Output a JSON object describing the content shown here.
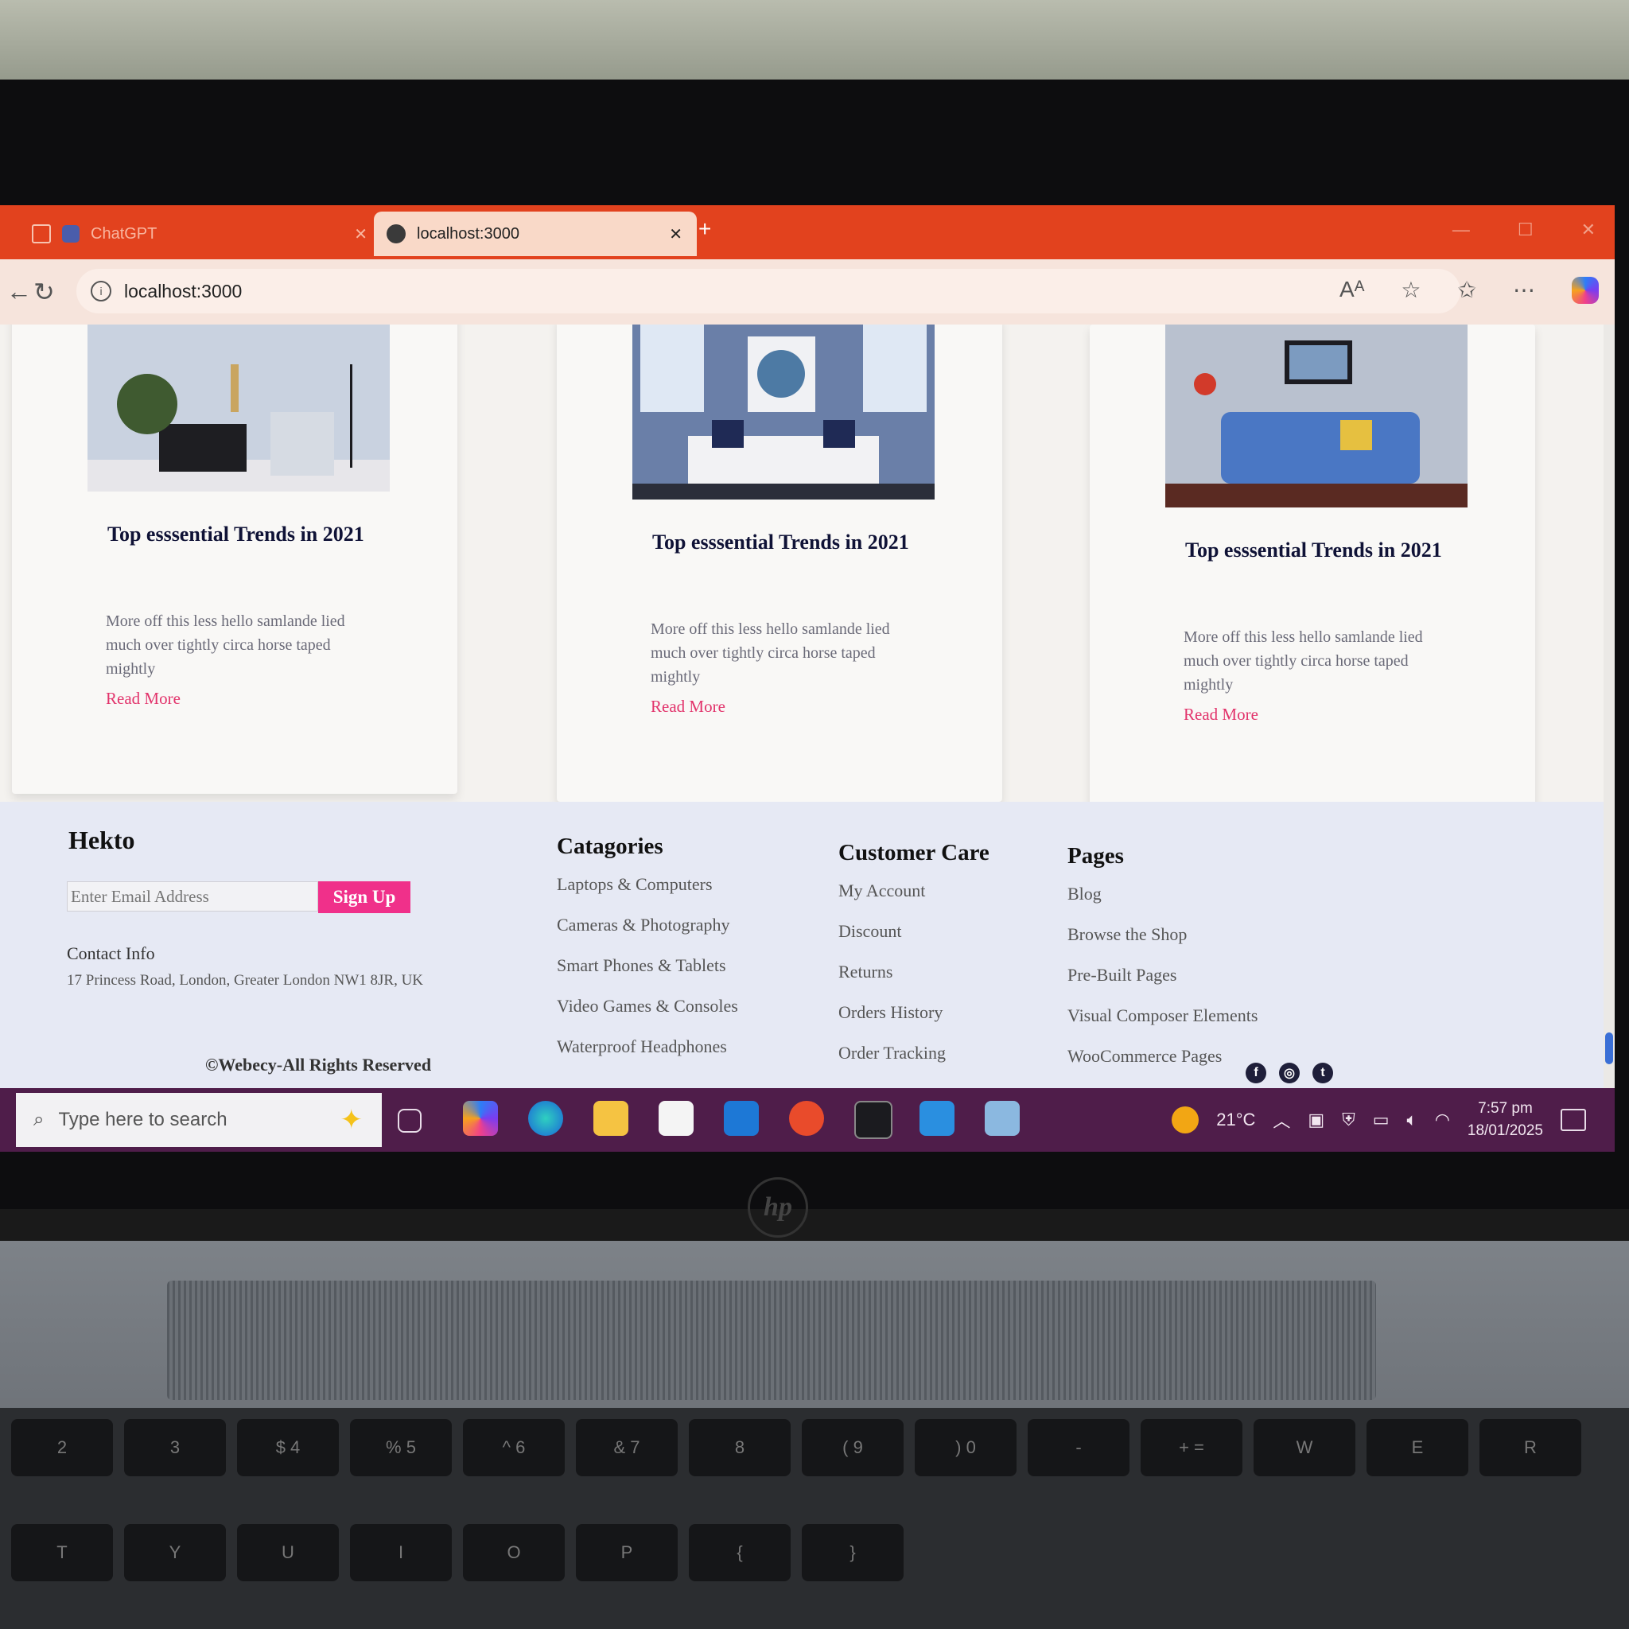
{
  "browser": {
    "tabs": [
      {
        "title": "ChatGPT",
        "active": false
      },
      {
        "title": "localhost:3000",
        "active": true
      }
    ],
    "new_tab": "+",
    "url": "localhost:3000",
    "accent": "#e2421e"
  },
  "blog": {
    "cards": [
      {
        "title": "Top esssential Trends in 2021",
        "description": "More off this less hello samlande lied much over tightly circa horse taped mightly",
        "link": "Read More"
      },
      {
        "title": "Top esssential Trends in 2021",
        "description": "More off this less hello samlande lied much over tightly circa horse taped mightly",
        "link": "Read More"
      },
      {
        "title": "Top esssential Trends in 2021",
        "description": "More off this less hello samlande lied much over tightly circa horse taped mightly",
        "link": "Read More"
      }
    ],
    "link_color": "#e2336b"
  },
  "footer": {
    "brand": "Hekto",
    "email_placeholder": "Enter Email Address",
    "signup_label": "Sign Up",
    "contact_label": "Contact Info",
    "contact_address": "17 Princess Road, London, Greater London NW1 8JR, UK",
    "columns": [
      {
        "heading": "Catagories",
        "items": [
          "Laptops & Computers",
          "Cameras & Photography",
          "Smart Phones & Tablets",
          "Video Games & Consoles",
          "Waterproof Headphones"
        ]
      },
      {
        "heading": "Customer Care",
        "items": [
          "My Account",
          "Discount",
          "Returns",
          "Orders History",
          "Order Tracking"
        ]
      },
      {
        "heading": "Pages",
        "items": [
          "Blog",
          "Browse the Shop",
          "Pre-Built Pages",
          "Visual Composer Elements",
          "WooCommerce Pages"
        ]
      }
    ],
    "copyright": "©Webecy-All Rights Reserved",
    "social_icons": [
      "facebook-icon",
      "instagram-icon",
      "twitter-icon"
    ],
    "accent": "#f0308a"
  },
  "taskbar": {
    "search_placeholder": "Type here to search",
    "temperature": "21°C",
    "time": "7:57 pm",
    "date": "18/01/2025",
    "color": "#4f1d4a"
  },
  "hardware": {
    "keyboard_top": [
      "2",
      "3",
      "$ 4",
      "% 5",
      "^ 6",
      "& 7",
      "8",
      "( 9",
      ") 0",
      "-",
      "+ ="
    ],
    "keyboard_row": [
      "W",
      "E",
      "R",
      "T",
      "Y",
      "U",
      "I",
      "O",
      "P",
      "{",
      "}"
    ]
  }
}
